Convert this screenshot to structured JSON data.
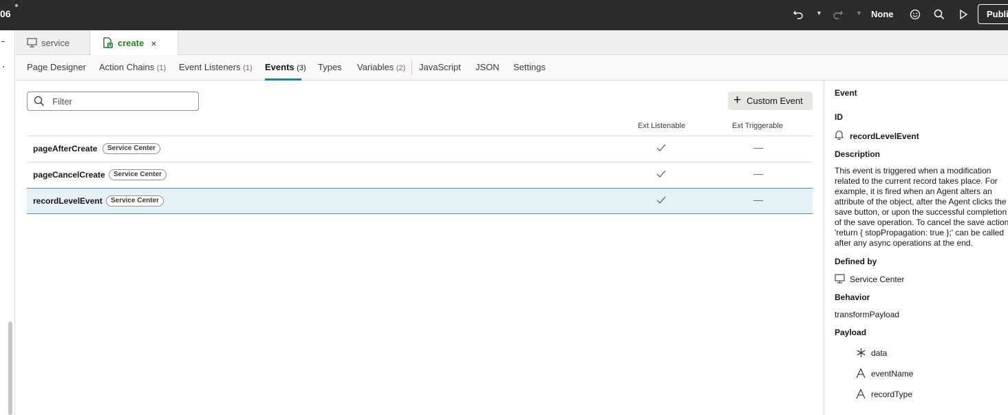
{
  "topbar": {
    "app_id": "06",
    "mode_label": "None",
    "publish_label": "Publis"
  },
  "file_tabs": [
    {
      "label": "service"
    },
    {
      "label": "create",
      "close": "×"
    }
  ],
  "subnav": [
    {
      "label": "Page Designer",
      "count": ""
    },
    {
      "label": "Action Chains",
      "count": "(1)"
    },
    {
      "label": "Event Listeners",
      "count": "(1)"
    },
    {
      "label": "Events",
      "count": "(3)"
    },
    {
      "label": "Types",
      "count": ""
    },
    {
      "label": "Variables",
      "count": "(2)"
    },
    {
      "label": "JavaScript",
      "count": ""
    },
    {
      "label": "JSON",
      "count": ""
    },
    {
      "label": "Settings",
      "count": ""
    }
  ],
  "main": {
    "filter_placeholder": "Filter",
    "custom_event_label": "Custom Event",
    "col_listenable": "Ext Listenable",
    "col_triggerable": "Ext Triggerable",
    "rows": [
      {
        "name": "pageAfterCreate",
        "badge": "Service Center"
      },
      {
        "name": "pageCancelCreate",
        "badge": "Service Center"
      },
      {
        "name": "recordLevelEvent",
        "badge": "Service Center"
      }
    ]
  },
  "detail": {
    "heading": "Event",
    "id_label": "ID",
    "id_value": "recordLevelEvent",
    "description_label": "Description",
    "description": "This event is triggered when a modification related to the current record takes place. For example, it is fired when an Agent alters an attribute of the object, after the Agent clicks the save button, or upon the successful completion of the save operation. To cancel the save action 'return { stopPropagation: true };' can be called after any async operations at the end.",
    "defined_by_label": "Defined by",
    "defined_by_value": "Service Center",
    "behavior_label": "Behavior",
    "behavior_value": "transformPayload",
    "payload_label": "Payload",
    "payload": [
      {
        "name": "data",
        "icon": "asterisk-icon"
      },
      {
        "name": "eventName",
        "icon": "string-type-icon"
      },
      {
        "name": "recordType",
        "icon": "string-type-icon"
      }
    ]
  }
}
